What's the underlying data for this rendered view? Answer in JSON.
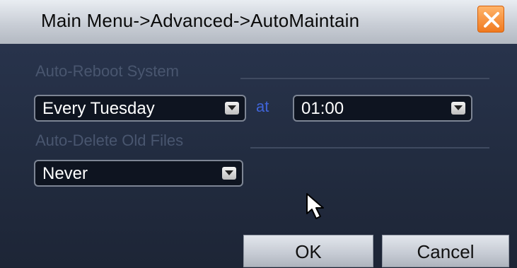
{
  "window": {
    "title": "Main Menu->Advanced->AutoMaintain"
  },
  "auto_reboot": {
    "section_label": "Auto-Reboot System",
    "day_value": "Every Tuesday",
    "at_label": "at",
    "time_value": "01:00"
  },
  "auto_delete": {
    "section_label": "Auto-Delete Old Files",
    "value": "Never"
  },
  "buttons": {
    "ok": "OK",
    "cancel": "Cancel"
  },
  "icons": {
    "close": "close-icon",
    "dropdown": "chevron-down-icon",
    "cursor": "mouse-cursor-icon"
  },
  "colors": {
    "background": "#222c40",
    "title_bar": "#c9ced6",
    "close_button": "#f07a20",
    "section_label": "#49566f",
    "at_label": "#3f64d8",
    "field_text": "#ffffff"
  }
}
